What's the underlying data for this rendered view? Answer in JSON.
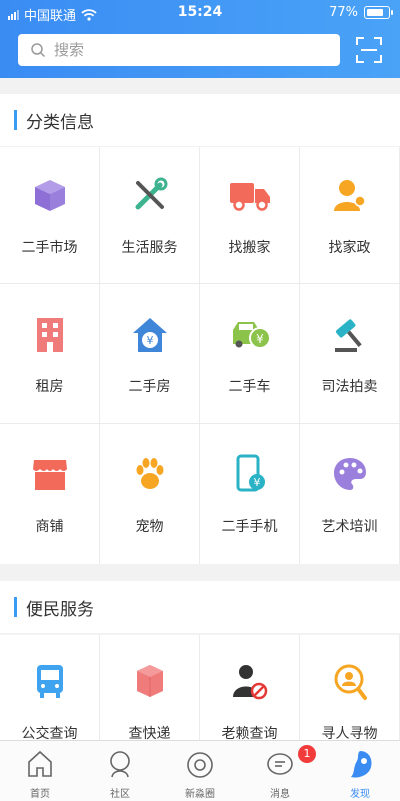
{
  "status": {
    "carrier": "中国联通",
    "time": "15:24",
    "battery": "77%"
  },
  "search": {
    "placeholder": "搜索"
  },
  "sections": {
    "category": {
      "title": "分类信息"
    },
    "service": {
      "title": "便民服务"
    }
  },
  "categories": [
    {
      "label": "二手市场",
      "icon": "box-icon",
      "color": "#9b7fdc"
    },
    {
      "label": "生活服务",
      "icon": "tools-icon",
      "color": "#3db38f"
    },
    {
      "label": "找搬家",
      "icon": "truck-icon",
      "color": "#f26a5a"
    },
    {
      "label": "找家政",
      "icon": "worker-icon",
      "color": "#f6a623"
    },
    {
      "label": "租房",
      "icon": "building-icon",
      "color": "#ef7b7b"
    },
    {
      "label": "二手房",
      "icon": "house-yen-icon",
      "color": "#3f86d9"
    },
    {
      "label": "二手车",
      "icon": "car-yen-icon",
      "color": "#8cc34a"
    },
    {
      "label": "司法拍卖",
      "icon": "gavel-icon",
      "color": "#2ab3c6"
    },
    {
      "label": "商铺",
      "icon": "shop-icon",
      "color": "#f26a5a"
    },
    {
      "label": "宠物",
      "icon": "paw-icon",
      "color": "#f6a623"
    },
    {
      "label": "二手手机",
      "icon": "phone-yen-icon",
      "color": "#2ab3c6"
    },
    {
      "label": "艺术培训",
      "icon": "palette-icon",
      "color": "#9b7fdc"
    }
  ],
  "services": [
    {
      "label": "公交查询",
      "icon": "bus-icon",
      "color": "#3fa3ef"
    },
    {
      "label": "查快递",
      "icon": "package-icon",
      "color": "#ef7b7b"
    },
    {
      "label": "老赖查询",
      "icon": "person-ban-icon",
      "color": "#333333"
    },
    {
      "label": "寻人寻物",
      "icon": "search-person-icon",
      "color": "#f6a623"
    }
  ],
  "tabs": [
    {
      "label": "首页",
      "icon": "home-icon"
    },
    {
      "label": "社区",
      "icon": "community-icon"
    },
    {
      "label": "新淼圈",
      "icon": "circle-icon"
    },
    {
      "label": "消息",
      "icon": "message-icon",
      "badge": "1"
    },
    {
      "label": "发现",
      "icon": "discover-icon",
      "active": true
    }
  ],
  "colors": {
    "header": "#3a8cf3",
    "accent": "#3a9cf5",
    "active_tab": "#3a8cf3"
  }
}
